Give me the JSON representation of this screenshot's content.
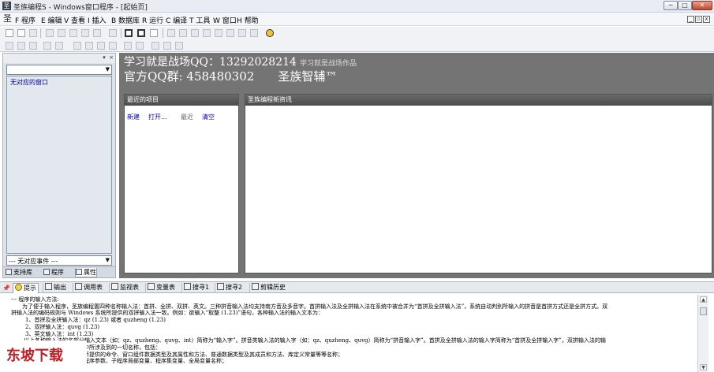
{
  "window": {
    "title": "圣族编程S - Windows窗口程序 - [起始页]",
    "app_icon": "圣",
    "controls": [
      "─",
      "□",
      "✕"
    ]
  },
  "menu": {
    "logo": "圣",
    "items": [
      "F 程序",
      "E 编辑",
      "V 查看",
      "I 插入",
      "B 数据库",
      "R 运行",
      "C 编译",
      "T 工具",
      "W 窗口",
      "H 帮助"
    ],
    "mdi_controls": [
      "_",
      "▫",
      "x"
    ]
  },
  "left_panel": {
    "header_controls": [
      "▾",
      "×"
    ],
    "object_combo": {
      "value": "",
      "arrow": "▼"
    },
    "event_list_empty": "无对应的窗口",
    "event_combo": {
      "value": "--- 无对应事件 ---",
      "arrow": "▼"
    },
    "tabs": [
      {
        "label": "支持库",
        "icon": "library-icon"
      },
      {
        "label": "程序",
        "icon": "program-icon"
      },
      {
        "label": "属性",
        "icon": "property-icon"
      }
    ]
  },
  "start_page": {
    "banner_big": "学习就是战场QQ：13292028214",
    "banner_small": "学习就是战场作品",
    "qq_group": "官方QQ群: 458480302",
    "brand": "圣族智辅™",
    "recent_panel": {
      "title": "最近的项目",
      "links": [
        "新建",
        "打开...",
        "最近",
        "清空"
      ]
    },
    "news_panel": {
      "title": "圣族编程新资讯"
    }
  },
  "output": {
    "pin": "📌",
    "tabs": [
      {
        "label": "提示",
        "icon": "tip-icon"
      },
      {
        "label": "输出",
        "icon": "output-icon"
      },
      {
        "label": "调用表",
        "icon": "call-table-icon"
      },
      {
        "label": "监视表",
        "icon": "watch-icon"
      },
      {
        "label": "变量表",
        "icon": "variable-icon"
      },
      {
        "label": "搜寻1",
        "icon": "search-icon"
      },
      {
        "label": "搜寻2",
        "icon": "search-icon"
      },
      {
        "label": "剪辑历史",
        "icon": "clipboard-icon"
      }
    ],
    "lines": [
      "--- 程序的输入方法:",
      "为了便于输入程序，圣族编程置四种名称输入法：首拼、全拼、双拼、英文。三种拼音输入法均支持南方音及多音字。首拼输入法及全拼输入法在系统中被合并为“首拼及全拼输入法”，系统自动判别所输入的拼音是首拼方式还是全拼方式。双",
      "拼输入法的编码规则与 Windows 系统所提供的双拼输入法一致。例如：欲输入“取整 (1.23)”语句，各种输入法的输入文本为：",
      "1、首拼及全拼输入法：qz (1.23) 或者 quzheng (1.23)",
      "2、双拼输入法：quvg (1.23)",
      "3、英文输入法：int (1.23)",
      "以上各种输入法的名部分输入文本（如：qz、quzheng、quvg、int）简称为“输入字”。拼音类输入法的输入字（如：qz、quzheng、quvg）简称为“拼音输入字”。首拼及全拼输入法的输入字简称为“首拼及全拼输入字”，双拼输入法的输",
      "程序中所涉及到的一切名称，包括：",
      "库中所提供的命令、窗口组件数据类型及其属性和方法、普通数据类型及其成员和方法、库定义常量等等名称；",
      "的子程序参数、子程序局部变量、程序集变量、全局变量名称；"
    ],
    "scroll": {
      "up": "▲",
      "down": "▼"
    }
  },
  "watermark": "东坡下载"
}
